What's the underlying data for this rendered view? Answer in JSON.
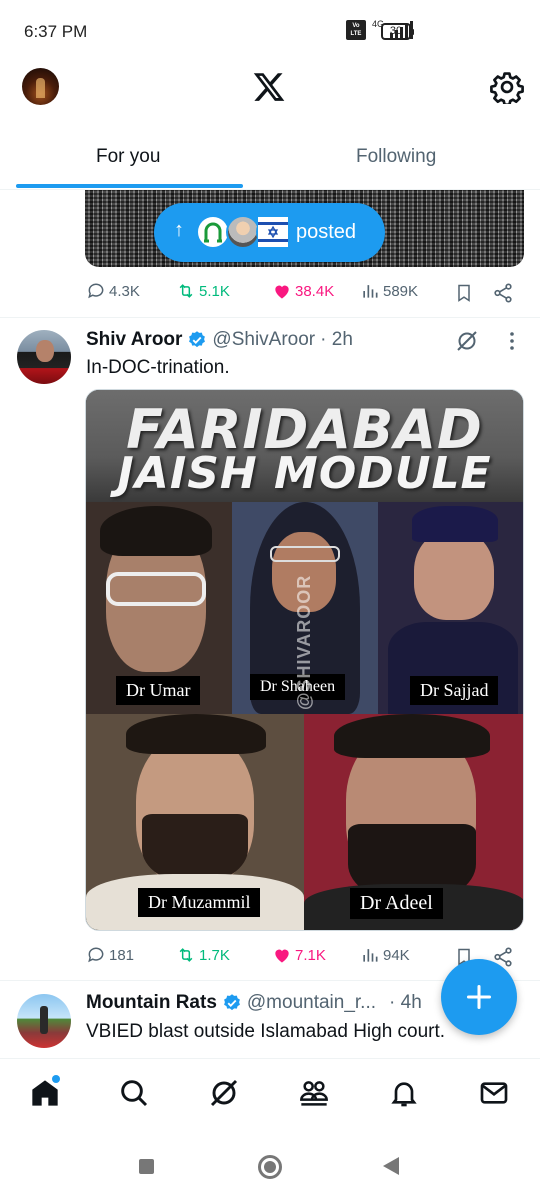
{
  "status_bar": {
    "time": "6:37 PM",
    "network": "4G",
    "volte": "Vo LTE",
    "battery": "30"
  },
  "header": {
    "logo": "x-logo",
    "avatar_icon": "profile-avatar",
    "settings_icon": "gear-icon"
  },
  "tabs": [
    {
      "label": "For you",
      "active": true
    },
    {
      "label": "Following",
      "active": false
    }
  ],
  "new_posts_pill": {
    "label": "posted",
    "arrow": "↑"
  },
  "prev_post": {
    "actions": {
      "replies": "4.3K",
      "reposts": "5.1K",
      "likes": "38.4K",
      "views": "589K"
    }
  },
  "post1": {
    "name": "Shiv Aroor",
    "handle": "@ShivAroor",
    "time": "· 2h",
    "text": "In-DOC-trination.",
    "media": {
      "title_line1": "FARIDABAD",
      "title_line2": "JAISH MODULE",
      "captions": [
        "Dr Umar",
        "Dr Shaheen",
        "Dr Sajjad",
        "Dr Muzammil",
        "Dr Adeel"
      ],
      "watermark": "@SHIVAROOR"
    },
    "actions": {
      "replies": "181",
      "reposts": "1.7K",
      "likes": "7.1K",
      "views": "94K"
    }
  },
  "post2": {
    "name": "Mountain Rats",
    "handle": "@mountain_r...",
    "time": "· 4h",
    "text": "VBIED blast outside Islamabad High court."
  },
  "fab": {
    "icon": "plus-icon"
  },
  "bottom_nav": [
    "home-icon",
    "search-icon",
    "grok-icon",
    "communities-icon",
    "notifications-icon",
    "messages-icon"
  ],
  "colors": {
    "accent": "#1d9bf0",
    "repost": "#00ba7c",
    "like": "#f91880",
    "muted": "#536471"
  }
}
